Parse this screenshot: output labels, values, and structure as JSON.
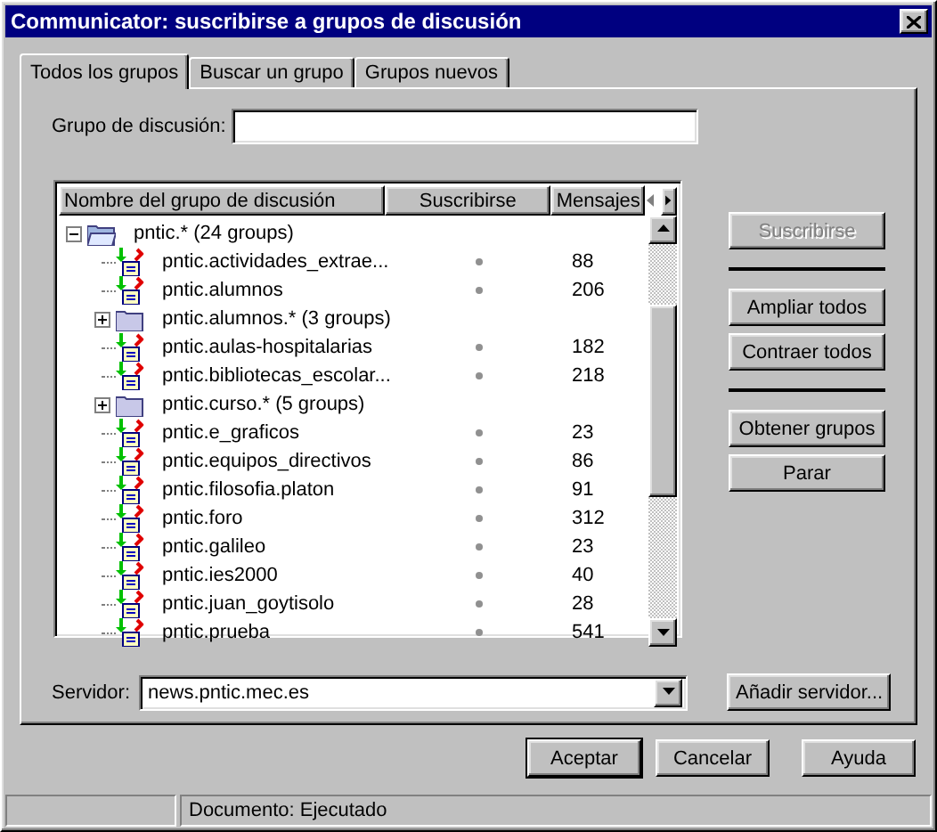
{
  "window": {
    "title": "Communicator: suscribirse a grupos de discusión"
  },
  "tabs": [
    {
      "label": "Todos los grupos",
      "selected": true
    },
    {
      "label": "Buscar un grupo",
      "selected": false
    },
    {
      "label": "Grupos nuevos",
      "selected": false
    }
  ],
  "group_field": {
    "label": "Grupo de discusión:"
  },
  "tree": {
    "columns": [
      "Nombre del grupo de discusión",
      "Suscribirse",
      "Mensajes"
    ],
    "items": [
      {
        "kind": "folder",
        "name": "pntic.* (24 groups)",
        "expanded": true,
        "children": [
          {
            "kind": "group",
            "name": "pntic.actividades_extrae...",
            "subscribed": false,
            "messages": "88"
          },
          {
            "kind": "group",
            "name": "pntic.alumnos",
            "subscribed": false,
            "messages": "206"
          },
          {
            "kind": "folder",
            "name": "pntic.alumnos.* (3 groups)",
            "expanded": false
          },
          {
            "kind": "group",
            "name": "pntic.aulas-hospitalarias",
            "subscribed": false,
            "messages": "182"
          },
          {
            "kind": "group",
            "name": "pntic.bibliotecas_escolar...",
            "subscribed": false,
            "messages": "218"
          },
          {
            "kind": "folder",
            "name": "pntic.curso.* (5 groups)",
            "expanded": false
          },
          {
            "kind": "group",
            "name": "pntic.e_graficos",
            "subscribed": false,
            "messages": "23"
          },
          {
            "kind": "group",
            "name": "pntic.equipos_directivos",
            "subscribed": false,
            "messages": "86"
          },
          {
            "kind": "group",
            "name": "pntic.filosofia.platon",
            "subscribed": false,
            "messages": "91"
          },
          {
            "kind": "group",
            "name": "pntic.foro",
            "subscribed": false,
            "messages": "312"
          },
          {
            "kind": "group",
            "name": "pntic.galileo",
            "subscribed": false,
            "messages": "23"
          },
          {
            "kind": "group",
            "name": "pntic.ies2000",
            "subscribed": false,
            "messages": "40"
          },
          {
            "kind": "group",
            "name": "pntic.juan_goytisolo",
            "subscribed": false,
            "messages": "28"
          },
          {
            "kind": "group",
            "name": "pntic.prueba",
            "subscribed": false,
            "messages": "541"
          }
        ]
      }
    ]
  },
  "side_buttons": [
    {
      "label": "Suscribirse",
      "disabled": true,
      "separator_after": true
    },
    {
      "label": "Ampliar todos",
      "disabled": false,
      "separator_after": false
    },
    {
      "label": "Contraer todos",
      "disabled": false,
      "separator_after": true
    },
    {
      "label": "Obtener grupos",
      "disabled": false,
      "separator_after": false
    },
    {
      "label": "Parar",
      "disabled": false,
      "separator_after": false
    }
  ],
  "server": {
    "label": "Servidor:",
    "value": "news.pntic.mec.es",
    "button": {
      "label": "Añadir servidor..."
    }
  },
  "dialog_buttons": [
    {
      "label": "Aceptar",
      "default": true
    },
    {
      "label": "Cancelar",
      "default": false
    },
    {
      "label": "Ayuda",
      "default": false
    }
  ],
  "status_bar": {
    "text": "Documento: Ejecutado"
  }
}
